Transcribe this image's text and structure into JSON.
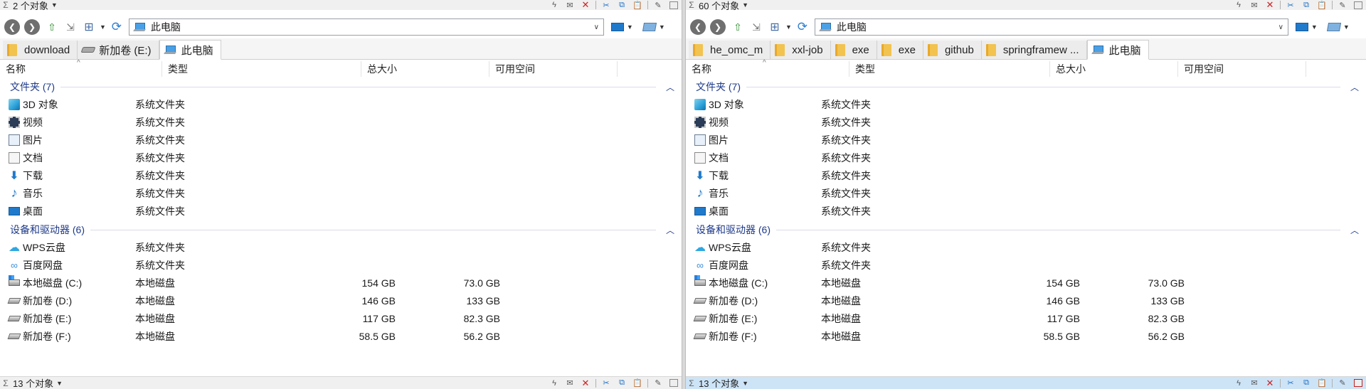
{
  "panes": [
    {
      "id": "left",
      "status_top": "2 个对象",
      "status_bottom": "13 个对象",
      "address": "此电脑",
      "tabs": [
        {
          "label": "download",
          "icon": "folder-icon",
          "active": false
        },
        {
          "label": "新加卷 (E:)",
          "icon": "drive-icon",
          "active": false
        },
        {
          "label": "此电脑",
          "icon": "computer-icon",
          "active": true
        }
      ],
      "columns": {
        "name": "名称",
        "type": "类型",
        "total": "总大小",
        "free": "可用空间"
      },
      "groups": [
        {
          "label": "文件夹 (7)"
        },
        {
          "label": "设备和驱动器 (6)"
        }
      ],
      "folders": [
        {
          "name": "3D 对象",
          "type": "系统文件夹",
          "icon": "obj3d"
        },
        {
          "name": "视频",
          "type": "系统文件夹",
          "icon": "video"
        },
        {
          "name": "图片",
          "type": "系统文件夹",
          "icon": "pic"
        },
        {
          "name": "文档",
          "type": "系统文件夹",
          "icon": "doc"
        },
        {
          "name": "下载",
          "type": "系统文件夹",
          "icon": "down"
        },
        {
          "name": "音乐",
          "type": "系统文件夹",
          "icon": "music"
        },
        {
          "name": "桌面",
          "type": "系统文件夹",
          "icon": "desk"
        }
      ],
      "devices": [
        {
          "name": "WPS云盘",
          "type": "系统文件夹",
          "total": "",
          "free": "",
          "icon": "cloud"
        },
        {
          "name": "百度网盘",
          "type": "系统文件夹",
          "total": "",
          "free": "",
          "icon": "baidu"
        },
        {
          "name": "本地磁盘 (C:)",
          "type": "本地磁盘",
          "total": "154 GB",
          "free": "73.0 GB",
          "icon": "sysdrive"
        },
        {
          "name": "新加卷 (D:)",
          "type": "本地磁盘",
          "total": "146 GB",
          "free": "133 GB",
          "icon": "drive"
        },
        {
          "name": "新加卷 (E:)",
          "type": "本地磁盘",
          "total": "117 GB",
          "free": "82.3 GB",
          "icon": "drive"
        },
        {
          "name": "新加卷 (F:)",
          "type": "本地磁盘",
          "total": "58.5 GB",
          "free": "56.2 GB",
          "icon": "drive"
        }
      ]
    },
    {
      "id": "right",
      "status_top": "60 个对象",
      "status_bottom": "13 个对象",
      "address": "此电脑",
      "tabs": [
        {
          "label": "he_omc_m",
          "icon": "folder-icon",
          "active": false
        },
        {
          "label": "xxl-job",
          "icon": "folder-icon",
          "active": false
        },
        {
          "label": "exe",
          "icon": "folder-icon",
          "active": false
        },
        {
          "label": "exe",
          "icon": "folder-icon",
          "active": false
        },
        {
          "label": "github",
          "icon": "folder-icon",
          "active": false
        },
        {
          "label": "springframew ...",
          "icon": "folder-icon",
          "active": false
        },
        {
          "label": "此电脑",
          "icon": "computer-icon",
          "active": true
        }
      ],
      "columns": {
        "name": "名称",
        "type": "类型",
        "total": "总大小",
        "free": "可用空间"
      },
      "groups": [
        {
          "label": "文件夹 (7)"
        },
        {
          "label": "设备和驱动器 (6)"
        }
      ],
      "folders": [
        {
          "name": "3D 对象",
          "type": "系统文件夹",
          "icon": "obj3d"
        },
        {
          "name": "视频",
          "type": "系统文件夹",
          "icon": "video"
        },
        {
          "name": "图片",
          "type": "系统文件夹",
          "icon": "pic"
        },
        {
          "name": "文档",
          "type": "系统文件夹",
          "icon": "doc"
        },
        {
          "name": "下载",
          "type": "系统文件夹",
          "icon": "down"
        },
        {
          "name": "音乐",
          "type": "系统文件夹",
          "icon": "music"
        },
        {
          "name": "桌面",
          "type": "系统文件夹",
          "icon": "desk"
        }
      ],
      "devices": [
        {
          "name": "WPS云盘",
          "type": "系统文件夹",
          "total": "",
          "free": "",
          "icon": "cloud"
        },
        {
          "name": "百度网盘",
          "type": "系统文件夹",
          "total": "",
          "free": "",
          "icon": "baidu"
        },
        {
          "name": "本地磁盘 (C:)",
          "type": "本地磁盘",
          "total": "154 GB",
          "free": "73.0 GB",
          "icon": "sysdrive"
        },
        {
          "name": "新加卷 (D:)",
          "type": "本地磁盘",
          "total": "146 GB",
          "free": "133 GB",
          "icon": "drive"
        },
        {
          "name": "新加卷 (E:)",
          "type": "本地磁盘",
          "total": "117 GB",
          "free": "82.3 GB",
          "icon": "drive"
        },
        {
          "name": "新加卷 (F:)",
          "type": "本地磁盘",
          "total": "58.5 GB",
          "free": "56.2 GB",
          "icon": "drive"
        }
      ]
    }
  ]
}
